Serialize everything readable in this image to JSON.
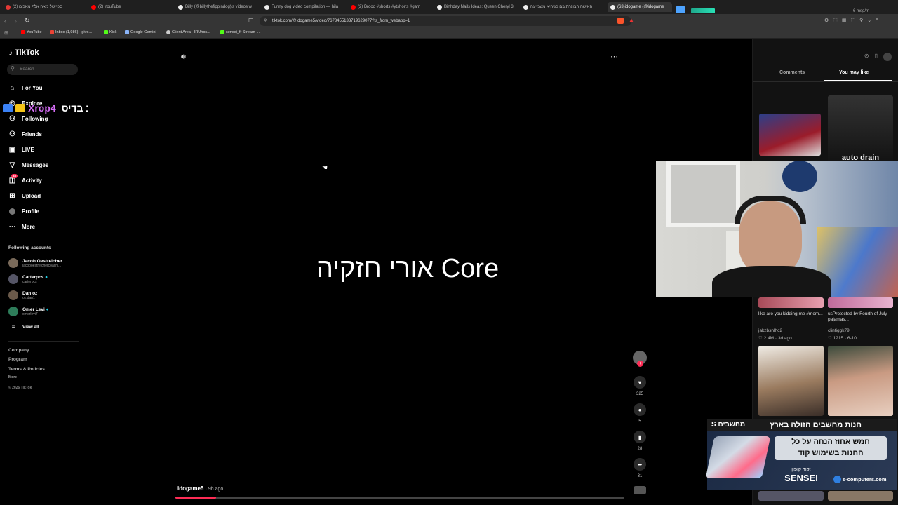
{
  "browser": {
    "tabs": [
      {
        "label": "ספיישל מאה אלף מאכים (2)",
        "color": "#e53935"
      },
      {
        "label": "(2) YouTube",
        "color": "#ff0000"
      },
      {
        "label": "Billy (@billythefippindog)'s videos w",
        "color": "#ffffff"
      },
      {
        "label": "Funny dog video compilation — hila",
        "color": "#ffffff"
      },
      {
        "label": "(2) Brooo #shorts #ytshorts #gam",
        "color": "#ff0000"
      },
      {
        "label": "Birthday Nails Ideas: Queen Cheryl 3",
        "color": "#ffffff"
      },
      {
        "label": "האישה הבוגרת בם כשהיא משמיעה",
        "color": "#ffffff"
      },
      {
        "label": "(63)idogame (@idogame",
        "color": "#ffffff"
      }
    ],
    "url": "tiktok.com/@idogame5/video/7673455133719629077?is_from_webapp=1",
    "bookmarks": [
      {
        "label": "YouTube",
        "color": "#ff0000"
      },
      {
        "label": "Inbox (1,986) - givo...",
        "color": "#ea4335"
      },
      {
        "label": "Kick",
        "color": "#53fc18"
      },
      {
        "label": "Google Gemini",
        "color": "#8ab4f8"
      },
      {
        "label": "Client Area - IRUhos...",
        "color": "#cccccc"
      },
      {
        "label": "sensei_fr Stream -...",
        "color": "#53fc18"
      }
    ],
    "stream_overlay": {
      "msg_rate": "6 msg/m"
    }
  },
  "sidebar": {
    "logo": "TikTok",
    "search_placeholder": "Search",
    "nav": [
      {
        "label": "For You",
        "icon": "home-icon",
        "glyph": "⌂"
      },
      {
        "label": "Explore",
        "icon": "compass-icon",
        "glyph": "◎"
      },
      {
        "label": "Following",
        "icon": "following-icon",
        "glyph": "⚇"
      },
      {
        "label": "Friends",
        "icon": "friends-icon",
        "glyph": "⚇"
      },
      {
        "label": "LIVE",
        "icon": "live-icon",
        "glyph": "▣"
      },
      {
        "label": "Messages",
        "icon": "messages-icon",
        "glyph": "▽"
      },
      {
        "label": "Activity",
        "icon": "activity-icon",
        "glyph": "◫",
        "badge": "63"
      },
      {
        "label": "Upload",
        "icon": "upload-icon",
        "glyph": "⊞"
      },
      {
        "label": "Profile",
        "icon": "profile-icon",
        "glyph": "●"
      },
      {
        "label": "More",
        "icon": "more-icon",
        "glyph": "⋯"
      }
    ],
    "following_title": "Following accounts",
    "accounts": [
      {
        "name": "Jacob Oestreicher",
        "handle": "jacoboestreichercoachl...",
        "color": "#7a6a5a"
      },
      {
        "name": "Carterpcs",
        "handle": "carterpcs",
        "color": "#555566",
        "verified": true
      },
      {
        "name": "Dan oz",
        "handle": "oz.dan1",
        "color": "#6b5a4a"
      },
      {
        "name": "Omer Levi",
        "handle": "omerlevi7",
        "color": "#2e7d5a",
        "verified": true
      }
    ],
    "view_all": "View all",
    "footer": [
      "Company",
      "Program",
      "Terms & Policies",
      "More",
      "© 2026 TikTok"
    ]
  },
  "chat_overlay": {
    "username": "Xrop4",
    "message": "שלח בתוכן ללייב בדיס :"
  },
  "video": {
    "text": "אורי חזקיה Core",
    "author": "idogame5",
    "age": "· 9h ago",
    "progress": 0.09,
    "actions": {
      "likes": "325",
      "comments": "5",
      "saves": "28",
      "shares": "31"
    }
  },
  "right_panel": {
    "tabs": [
      "Comments",
      "You may like"
    ],
    "active_tab": "You may like",
    "thumb_text": "auto drain",
    "cards": [
      {
        "caption": "like are you kidding me #mom...",
        "author": "jakzbsnlhc2",
        "stats": "♡ 2.4M · 3d ago"
      },
      {
        "caption": "usProtected by Fourth of July pajamas...",
        "author": "clintiggk79",
        "stats": "♡ 1215 · 6-10"
      }
    ]
  },
  "ad": {
    "brand_line": "חנות מחשבים הזולה בארץ",
    "brand_tag": "S מחשבים",
    "offer_line1": "חמש אחוז הנחה על כל",
    "offer_line2": "החנות בשימוש קוד",
    "code_label": "קוד קופון:",
    "code": "SENSEI",
    "site": "s-computers.com"
  }
}
